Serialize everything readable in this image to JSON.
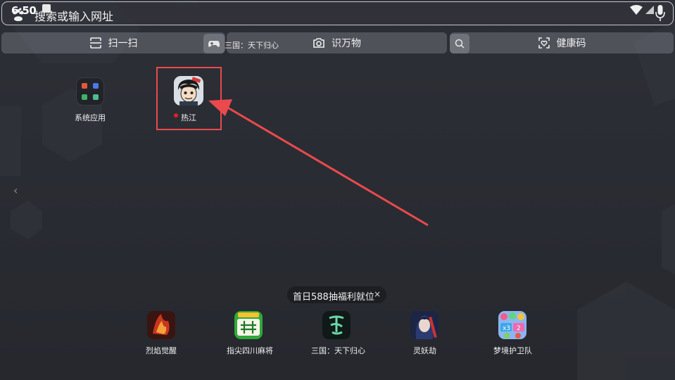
{
  "status": {
    "time": "6:50"
  },
  "search": {
    "placeholder": "搜索或输入网址"
  },
  "tools": {
    "scan": "扫一扫",
    "identify": "识万物",
    "health_code": "健康码",
    "game_suggestion": "三国：天下归心"
  },
  "desktop": {
    "apps": [
      {
        "label": "系统应用"
      },
      {
        "label": "热江"
      }
    ]
  },
  "promo": {
    "text": "首日588抽福利就位",
    "close": "×"
  },
  "dock": [
    {
      "label": "烈焰觉醒"
    },
    {
      "label": "指尖四川麻将"
    },
    {
      "label": "三国：天下归心"
    },
    {
      "label": "灵妖劫"
    },
    {
      "label": "梦境护卫队"
    }
  ],
  "colors": {
    "highlight": "#ea4a4d",
    "badge": "#e02020"
  }
}
